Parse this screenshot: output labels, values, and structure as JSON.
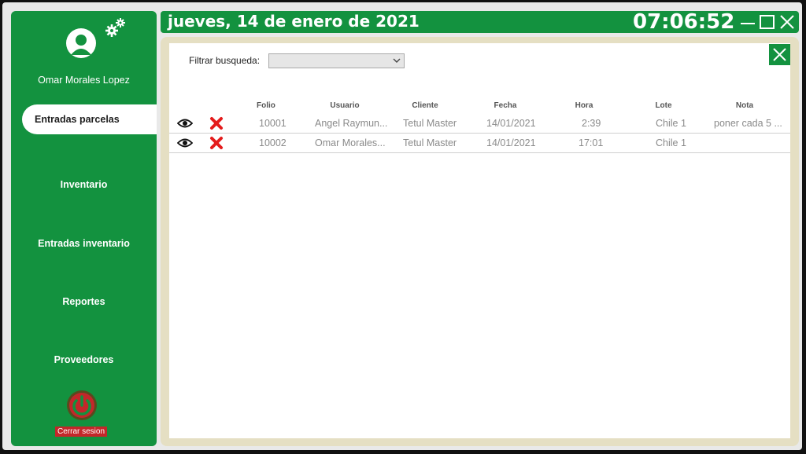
{
  "header": {
    "date": "jueves, 14 de enero de 2021",
    "time": "07:06:52"
  },
  "sidebar": {
    "user_name": "Omar Morales Lopez",
    "items": [
      {
        "label": "Entradas parcelas",
        "active": true
      },
      {
        "label": "Inventario"
      },
      {
        "label": "Entradas inventario"
      },
      {
        "label": "Reportes"
      },
      {
        "label": "Proveedores"
      }
    ],
    "logout_label": "Cerrar sesion"
  },
  "filter": {
    "label": "Filtrar busqueda:",
    "value": ""
  },
  "table": {
    "columns": [
      "Folio",
      "Usuario",
      "Cliente",
      "Fecha",
      "Hora",
      "Lote",
      "Nota"
    ],
    "rows": [
      {
        "folio": "10001",
        "usuario": "Angel Raymun...",
        "cliente": "Tetul Master",
        "fecha": "14/01/2021",
        "hora": "2:39",
        "lote": "Chile 1",
        "nota": "poner cada 5 ..."
      },
      {
        "folio": "10002",
        "usuario": "Omar Morales...",
        "cliente": "Tetul Master",
        "fecha": "14/01/2021",
        "hora": "17:01",
        "lote": "Chile 1",
        "nota": ""
      }
    ]
  },
  "colors": {
    "brand_green": "#13923f",
    "panel_border": "#e5dfc3",
    "danger": "#c3272a"
  }
}
